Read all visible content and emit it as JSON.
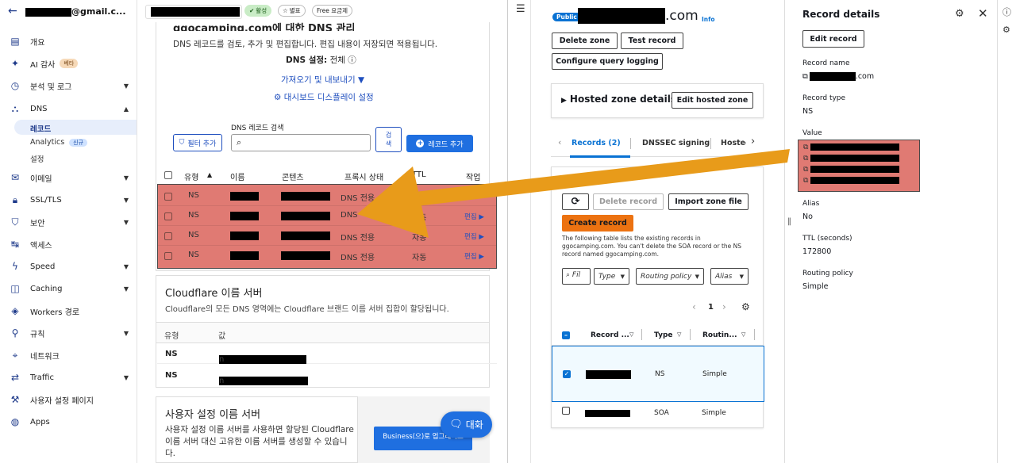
{
  "cf": {
    "account_email": "@gmail.c...",
    "status_active": "활성",
    "star_label": "별표",
    "plan_label": "Free 요금제",
    "title": "ggocamping.com에 대한 DNS 관리",
    "desc": "DNS 레코드를 검토, 추가 및 편집합니다. 편집 내용이 저장되면 적용됩니다.",
    "dns_setting_label": "DNS 설정:",
    "dns_setting_value": "전체",
    "import_export": "가져오기 및 내보내기",
    "dashboard_display": "대시보드 디스플레이 설정",
    "search_label": "DNS 레코드 검색",
    "filter_btn": "필터 추가",
    "search_btn": "검색",
    "add_record_btn": "레코드 추가",
    "table_headers": [
      "유형",
      "이름",
      "콘텐츠",
      "프록시 상태",
      "TTL",
      "작업"
    ],
    "records": [
      {
        "type": "NS",
        "proxy": "DNS 전용",
        "ttl": "자동",
        "action": ""
      },
      {
        "type": "NS",
        "proxy": "DNS",
        "ttl": "자동",
        "action": "편집"
      },
      {
        "type": "NS",
        "proxy": "DNS 전용",
        "ttl": "자동",
        "action": "편집"
      },
      {
        "type": "NS",
        "proxy": "DNS 전용",
        "ttl": "자동",
        "action": "편집"
      }
    ],
    "ns_section_title": "Cloudflare 이름 서버",
    "ns_section_desc": "Cloudflare의 모든 DNS 영역에는 Cloudflare 브랜드 이름 서버 집합이 할당됩니다.",
    "ns_headers": [
      "유형",
      "값"
    ],
    "ns_rows": [
      {
        "type": "NS",
        "suffix": "n"
      },
      {
        "type": "NS",
        "suffix": "n"
      }
    ],
    "custom_ns_title": "사용자 설정 이름 서버",
    "custom_ns_desc1": "사용자 설정 이름 서버를 사용하면 할당된 Cloudflare",
    "custom_ns_desc2": "이름 서버 대신 고유한 이름 서버를 생성할 수 있습니다.",
    "upgrade_btn": "Business(으)로 업그레이드",
    "chat_btn": "대화",
    "sidebar": [
      {
        "label": "개요",
        "icon": "doc-icon",
        "chevron": false
      },
      {
        "label": "AI 감사",
        "icon": "ai-icon",
        "chevron": false,
        "badge": "베타"
      },
      {
        "label": "분석 및 로그",
        "icon": "clock-icon",
        "chevron": true
      },
      {
        "label": "DNS",
        "icon": "dns-icon",
        "chevron": true
      },
      {
        "label": "이메일",
        "icon": "mail-icon",
        "chevron": true
      },
      {
        "label": "SSL/TLS",
        "icon": "lock-icon",
        "chevron": true
      },
      {
        "label": "보안",
        "icon": "shield-icon",
        "chevron": true
      },
      {
        "label": "액세스",
        "icon": "access-icon",
        "chevron": false
      },
      {
        "label": "Speed",
        "icon": "bolt-icon",
        "chevron": true
      },
      {
        "label": "Caching",
        "icon": "cache-icon",
        "chevron": true
      },
      {
        "label": "Workers 경로",
        "icon": "workers-icon",
        "chevron": false
      },
      {
        "label": "규칙",
        "icon": "rules-icon",
        "chevron": true
      },
      {
        "label": "네트워크",
        "icon": "pin-icon",
        "chevron": false
      },
      {
        "label": "Traffic",
        "icon": "traffic-icon",
        "chevron": true
      },
      {
        "label": "사용자 설정 페이지",
        "icon": "wrench-icon",
        "chevron": false
      },
      {
        "label": "Apps",
        "icon": "apps-icon",
        "chevron": false
      }
    ],
    "dns_sub": {
      "records": "레코드",
      "analytics": "Analytics",
      "analytics_badge": "신규",
      "settings": "설정"
    }
  },
  "aws": {
    "public_badge": "Public",
    "zone_suffix": ".com",
    "info_link": "Info",
    "delete_zone": "Delete zone",
    "test_record": "Test record",
    "configure_logging": "Configure query logging",
    "hosted_zone_details": "Hosted zone details",
    "edit_hosted_zone": "Edit hosted zone",
    "tabs": [
      "Records (2)",
      "DNSSEC signing",
      "Hosted"
    ],
    "delete_record": "Delete record",
    "import_zone": "Import zone file",
    "create_record": "Create record",
    "table_note": "The following table lists the existing records in ggocamping.com. You can't delete the SOA record or the NS record named ggocamping.com.",
    "filter_placeholder": "Fil",
    "filters": [
      "Type",
      "Routing policy",
      "Alias"
    ],
    "page": "1",
    "col_headers": [
      "Record ...",
      "Type",
      "Routin..."
    ],
    "rows": [
      {
        "type": "NS",
        "routing": "Simple",
        "checked": true
      },
      {
        "type": "SOA",
        "routing": "Simple",
        "checked": false
      }
    ]
  },
  "details": {
    "title": "Record details",
    "edit_record": "Edit record",
    "record_name_label": "Record name",
    "record_name_suffix": ".com",
    "record_type_label": "Record type",
    "record_type": "NS",
    "value_label": "Value",
    "alias_label": "Alias",
    "alias": "No",
    "ttl_label": "TTL (seconds)",
    "ttl": "172800",
    "routing_label": "Routing policy",
    "routing": "Simple"
  },
  "colors": {
    "cf_blue": "#1f6fe0",
    "highlight_red": "#e07a73",
    "aws_orange": "#ec7211",
    "arrow_orange": "#e89b1a"
  }
}
